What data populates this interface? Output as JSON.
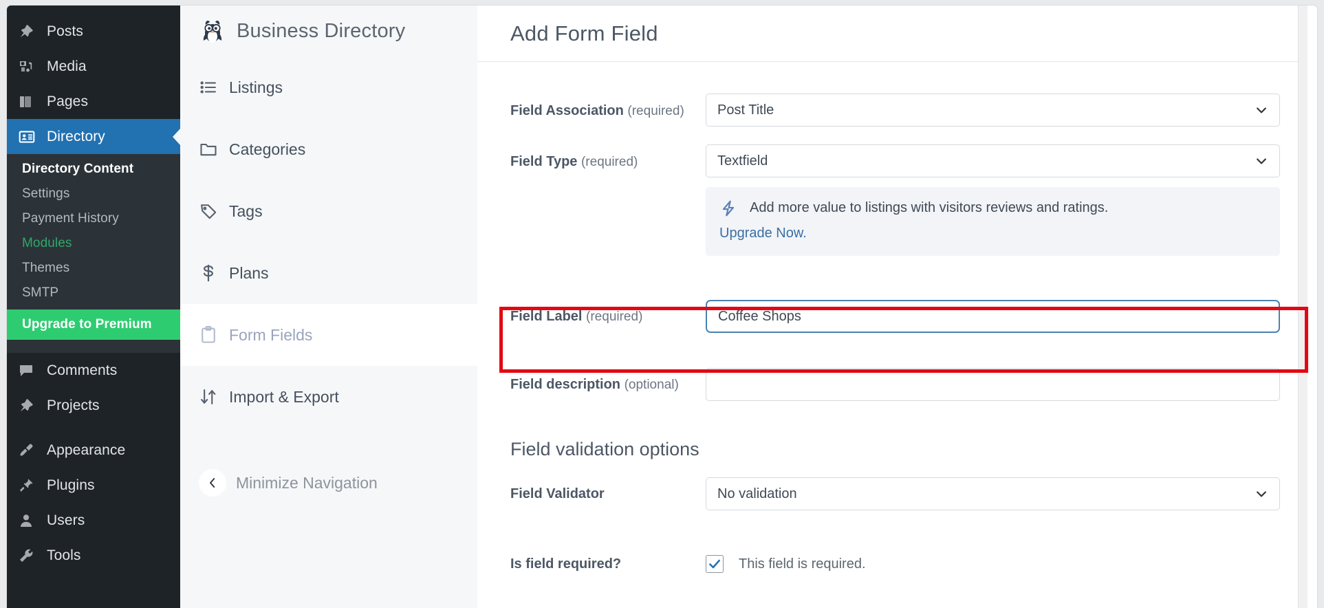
{
  "wp_sidebar": {
    "items": [
      {
        "label": "Posts",
        "icon": "pin-icon",
        "active": false
      },
      {
        "label": "Media",
        "icon": "media-icon",
        "active": false
      },
      {
        "label": "Pages",
        "icon": "pages-icon",
        "active": false
      },
      {
        "label": "Directory",
        "icon": "directory-card-icon",
        "active": true
      }
    ],
    "submenu": [
      {
        "label": "Directory Content",
        "style": "current"
      },
      {
        "label": "Settings",
        "style": "normal"
      },
      {
        "label": "Payment History",
        "style": "normal"
      },
      {
        "label": "Modules",
        "style": "modules"
      },
      {
        "label": "Themes",
        "style": "normal"
      },
      {
        "label": "SMTP",
        "style": "normal"
      },
      {
        "label": "Upgrade to Premium",
        "style": "premium"
      }
    ],
    "items_bottom": [
      {
        "label": "Comments",
        "icon": "comment-icon"
      },
      {
        "label": "Projects",
        "icon": "pin-icon"
      },
      {
        "label": "Appearance",
        "icon": "paintbrush-icon"
      },
      {
        "label": "Plugins",
        "icon": "plug-icon"
      },
      {
        "label": "Users",
        "icon": "user-icon"
      },
      {
        "label": "Tools",
        "icon": "wrench-icon"
      }
    ],
    "accent_active": "#2271b1",
    "accent_premium": "#2ecc71",
    "accent_modules": "#2ea86a"
  },
  "plugin_nav": {
    "brand": "Business Directory",
    "logo_icon": "penguin-logo-icon",
    "items": [
      {
        "label": "Listings",
        "icon": "list-icon",
        "selected": false
      },
      {
        "label": "Categories",
        "icon": "folder-icon",
        "selected": false
      },
      {
        "label": "Tags",
        "icon": "tag-icon",
        "selected": false
      },
      {
        "label": "Plans",
        "icon": "dollar-icon",
        "selected": false
      },
      {
        "label": "Form Fields",
        "icon": "clipboard-icon",
        "selected": true
      },
      {
        "label": "Import & Export",
        "icon": "import-export-icon",
        "selected": false
      }
    ],
    "minimize_label": "Minimize Navigation",
    "minimize_icon": "chevron-left-icon"
  },
  "main": {
    "title": "Add Form Field",
    "field_association": {
      "label": "Field Association",
      "qualifier": "(required)",
      "value": "Post Title"
    },
    "field_type": {
      "label": "Field Type",
      "qualifier": "(required)",
      "value": "Textfield"
    },
    "notice": {
      "icon": "bolt-icon",
      "text": "Add more value to listings with visitors reviews and ratings.",
      "link": "Upgrade Now."
    },
    "field_label": {
      "label": "Field Label",
      "qualifier": "(required)",
      "value": "Coffee Shops",
      "focused": true
    },
    "field_description": {
      "label": "Field description",
      "qualifier": "(optional)",
      "value": "",
      "placeholder": ""
    },
    "validation_section_title": "Field validation options",
    "field_validator": {
      "label": "Field Validator",
      "qualifier": "",
      "value": "No validation"
    },
    "is_required": {
      "label": "Is field required?",
      "checkbox_label": "This field is required.",
      "checked": true
    },
    "highlight_color": "#e30613"
  }
}
